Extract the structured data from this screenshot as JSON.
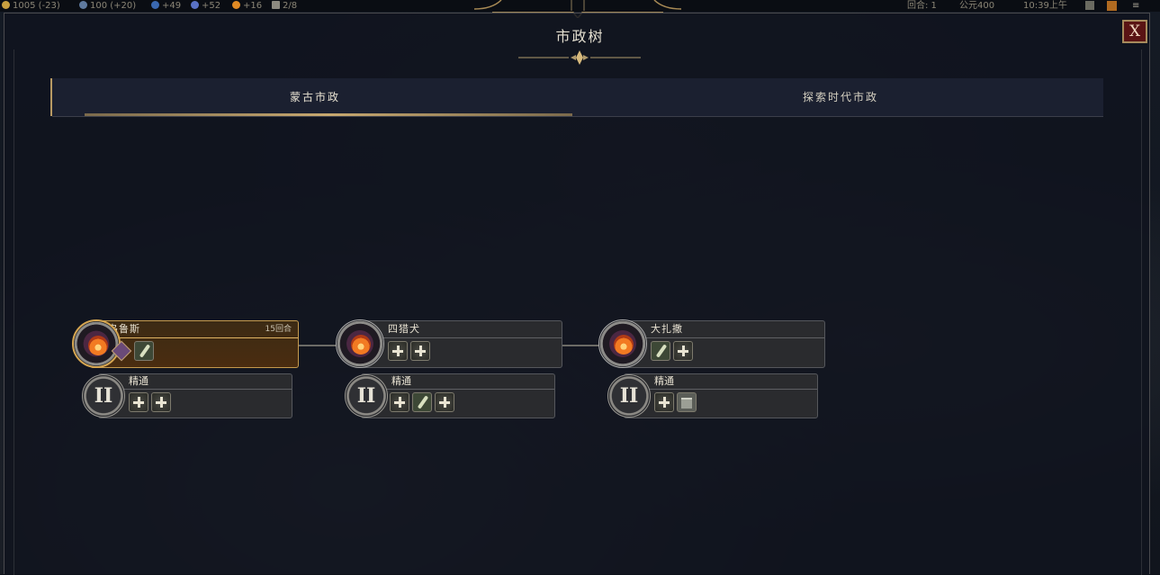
{
  "topbar": {
    "gold": "1005",
    "gold_delta": "(-23)",
    "science": "100",
    "science_delta": "(+20)",
    "influence": "+49",
    "culture": "+52",
    "happiness": "+16",
    "settlements": "2/8",
    "turn": "回合: 1",
    "year": "公元400",
    "clock": "10:39上午"
  },
  "window": {
    "title": "市政树",
    "close_label": "X"
  },
  "tabs": [
    {
      "label": "蒙古市政",
      "active": true
    },
    {
      "label": "探索时代市政",
      "active": false
    }
  ],
  "civics": [
    {
      "name": "乌鲁斯",
      "turns": "15回合",
      "icons": [
        "diamond-icon",
        "quill-icon"
      ],
      "active": true,
      "mastery": {
        "numeral": "II",
        "name": "精通",
        "icons": [
          "plus-icon",
          "plus-icon"
        ]
      }
    },
    {
      "name": "四猎犬",
      "turns": "",
      "icons": [
        "plus-icon",
        "plus-icon"
      ],
      "active": false,
      "mastery": {
        "numeral": "II",
        "name": "精通",
        "icons": [
          "plus-icon",
          "quill-icon",
          "plus-icon"
        ]
      }
    },
    {
      "name": "大扎撒",
      "turns": "",
      "icons": [
        "quill-icon",
        "plus-icon"
      ],
      "active": false,
      "mastery": {
        "numeral": "II",
        "name": "精通",
        "icons": [
          "plus-icon",
          "building-icon"
        ]
      }
    }
  ],
  "colors": {
    "accent_gold": "#c7a86f",
    "close_red": "#5a1414",
    "panel_bg": "#10141e"
  }
}
